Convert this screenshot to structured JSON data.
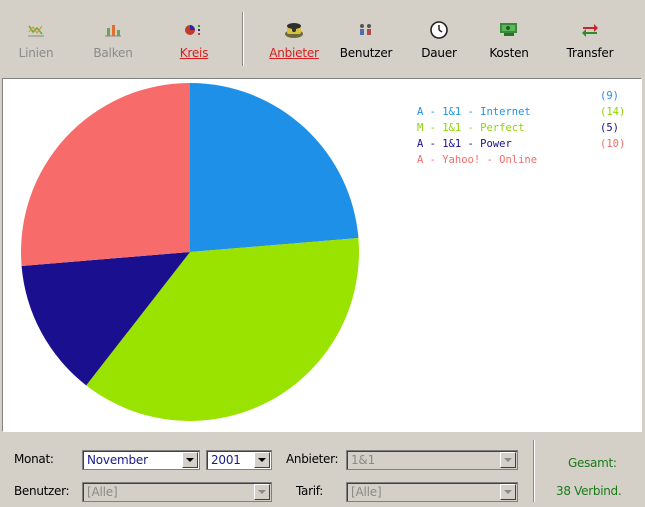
{
  "toolbar": {
    "buttons": [
      {
        "id": "linien",
        "label": "Linien",
        "icon": "line-chart-icon",
        "state": "disabled"
      },
      {
        "id": "balken",
        "label": "Balken",
        "icon": "bar-chart-icon",
        "state": "disabled"
      },
      {
        "id": "kreis",
        "label": "Kreis",
        "icon": "pie-chart-icon",
        "state": "active"
      },
      {
        "id": "anbieter",
        "label": "Anbieter",
        "icon": "phone-icon",
        "state": "active"
      },
      {
        "id": "benutzer",
        "label": "Benutzer",
        "icon": "users-icon",
        "state": "normal"
      },
      {
        "id": "dauer",
        "label": "Dauer",
        "icon": "clock-icon",
        "state": "normal"
      },
      {
        "id": "kosten",
        "label": "Kosten",
        "icon": "money-icon",
        "state": "normal"
      },
      {
        "id": "transfer",
        "label": "Transfer",
        "icon": "transfer-arrows-icon",
        "state": "normal"
      }
    ]
  },
  "legend": [
    {
      "text": "A - 1&1 - Internet",
      "count": "(9)",
      "color": "#1e90e8"
    },
    {
      "text": "M - 1&1 - Perfect",
      "count": "(14)",
      "color": "#8fd400"
    },
    {
      "text": "A - 1&1 - Power",
      "count": "(5)",
      "color": "#1a0f8f"
    },
    {
      "text": "A - Yahoo! - Online",
      "count": "(10)",
      "color": "#f76b6b"
    }
  ],
  "chart_data": {
    "type": "pie",
    "categories": [
      "A - 1&1 - Internet",
      "M - 1&1 - Perfect",
      "A - 1&1 - Power",
      "A - Yahoo! - Online"
    ],
    "values": [
      9,
      14,
      5,
      10
    ],
    "colors": [
      "#1e90e8",
      "#9ae300",
      "#1a0f8f",
      "#f76b6b"
    ],
    "legend_position": "top-right"
  },
  "controls": {
    "monat_label": "Monat:",
    "monat_value": "November",
    "jahr_value": "2001",
    "anbieter_label": "Anbieter:",
    "anbieter_value": "1&1",
    "benutzer_label": "Benutzer:",
    "benutzer_value": "[Alle]",
    "tarif_label": "Tarif:",
    "tarif_value": "[Alle]"
  },
  "summary": {
    "gesamt_label": "Gesamt:",
    "total_value": "38 Verbind."
  }
}
